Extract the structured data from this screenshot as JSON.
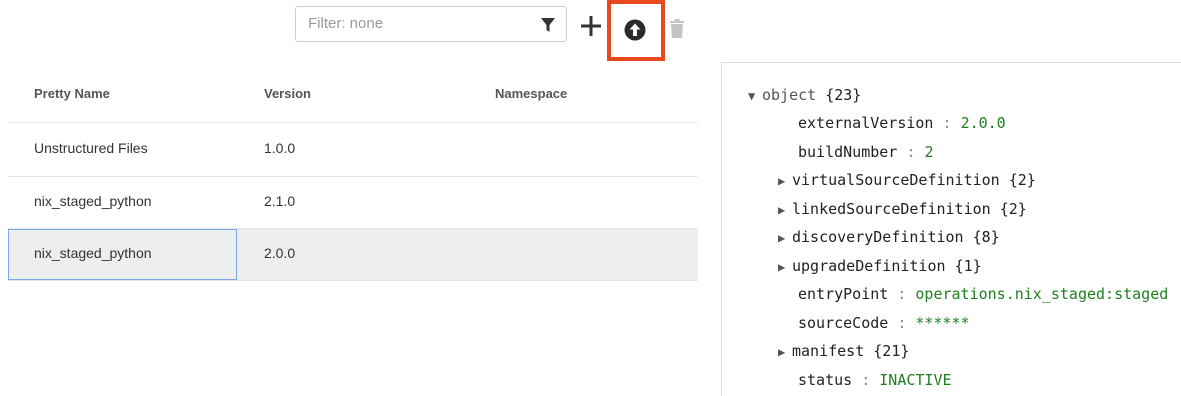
{
  "toolbar": {
    "filter_placeholder": "Filter: none",
    "filter_icon": "filter-icon",
    "add_icon": "plus-icon",
    "upload_icon": "upload-circle-icon",
    "delete_icon": "trash-icon",
    "highlight_color": "#e84a1f"
  },
  "table": {
    "columns": [
      "Pretty Name",
      "Version",
      "Namespace"
    ],
    "rows": [
      {
        "name": "Unstructured Files",
        "version": "1.0.0",
        "namespace": ""
      },
      {
        "name": "nix_staged_python",
        "version": "2.1.0",
        "namespace": ""
      },
      {
        "name": "nix_staged_python",
        "version": "2.0.0",
        "namespace": ""
      }
    ],
    "selected_row_index": 2
  },
  "tree": {
    "root": "object",
    "root_count": "{23}",
    "externalVersion": {
      "key": "externalVersion",
      "value": "2.0.0"
    },
    "buildNumber": {
      "key": "buildNumber",
      "value": "2"
    },
    "virtualSourceDefinition": {
      "key": "virtualSourceDefinition",
      "count": "{2}"
    },
    "linkedSourceDefinition": {
      "key": "linkedSourceDefinition",
      "count": "{2}"
    },
    "discoveryDefinition": {
      "key": "discoveryDefinition",
      "count": "{8}"
    },
    "upgradeDefinition": {
      "key": "upgradeDefinition",
      "count": "{1}"
    },
    "entryPoint": {
      "key": "entryPoint",
      "value": "operations.nix_staged:staged"
    },
    "sourceCode": {
      "key": "sourceCode",
      "value": "******"
    },
    "manifest": {
      "key": "manifest",
      "count": "{21}"
    },
    "status": {
      "key": "status",
      "value": "INACTIVE"
    },
    "colon": ":",
    "value_color": "#1f7f1f"
  }
}
